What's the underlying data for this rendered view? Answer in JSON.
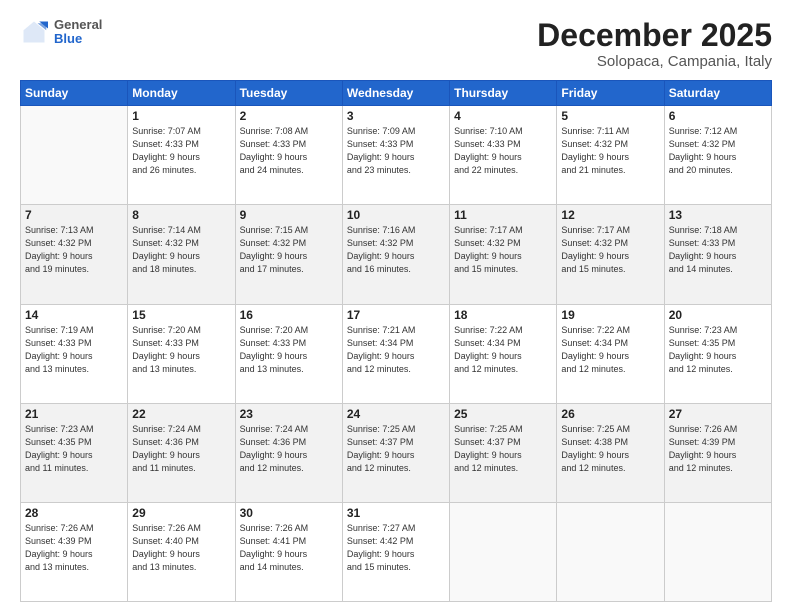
{
  "logo": {
    "general": "General",
    "blue": "Blue"
  },
  "header": {
    "month": "December 2025",
    "location": "Solopaca, Campania, Italy"
  },
  "days_of_week": [
    "Sunday",
    "Monday",
    "Tuesday",
    "Wednesday",
    "Thursday",
    "Friday",
    "Saturday"
  ],
  "weeks": [
    [
      {
        "day": "",
        "info": ""
      },
      {
        "day": "1",
        "info": "Sunrise: 7:07 AM\nSunset: 4:33 PM\nDaylight: 9 hours\nand 26 minutes."
      },
      {
        "day": "2",
        "info": "Sunrise: 7:08 AM\nSunset: 4:33 PM\nDaylight: 9 hours\nand 24 minutes."
      },
      {
        "day": "3",
        "info": "Sunrise: 7:09 AM\nSunset: 4:33 PM\nDaylight: 9 hours\nand 23 minutes."
      },
      {
        "day": "4",
        "info": "Sunrise: 7:10 AM\nSunset: 4:33 PM\nDaylight: 9 hours\nand 22 minutes."
      },
      {
        "day": "5",
        "info": "Sunrise: 7:11 AM\nSunset: 4:32 PM\nDaylight: 9 hours\nand 21 minutes."
      },
      {
        "day": "6",
        "info": "Sunrise: 7:12 AM\nSunset: 4:32 PM\nDaylight: 9 hours\nand 20 minutes."
      }
    ],
    [
      {
        "day": "7",
        "info": "Sunrise: 7:13 AM\nSunset: 4:32 PM\nDaylight: 9 hours\nand 19 minutes."
      },
      {
        "day": "8",
        "info": "Sunrise: 7:14 AM\nSunset: 4:32 PM\nDaylight: 9 hours\nand 18 minutes."
      },
      {
        "day": "9",
        "info": "Sunrise: 7:15 AM\nSunset: 4:32 PM\nDaylight: 9 hours\nand 17 minutes."
      },
      {
        "day": "10",
        "info": "Sunrise: 7:16 AM\nSunset: 4:32 PM\nDaylight: 9 hours\nand 16 minutes."
      },
      {
        "day": "11",
        "info": "Sunrise: 7:17 AM\nSunset: 4:32 PM\nDaylight: 9 hours\nand 15 minutes."
      },
      {
        "day": "12",
        "info": "Sunrise: 7:17 AM\nSunset: 4:32 PM\nDaylight: 9 hours\nand 15 minutes."
      },
      {
        "day": "13",
        "info": "Sunrise: 7:18 AM\nSunset: 4:33 PM\nDaylight: 9 hours\nand 14 minutes."
      }
    ],
    [
      {
        "day": "14",
        "info": "Sunrise: 7:19 AM\nSunset: 4:33 PM\nDaylight: 9 hours\nand 13 minutes."
      },
      {
        "day": "15",
        "info": "Sunrise: 7:20 AM\nSunset: 4:33 PM\nDaylight: 9 hours\nand 13 minutes."
      },
      {
        "day": "16",
        "info": "Sunrise: 7:20 AM\nSunset: 4:33 PM\nDaylight: 9 hours\nand 13 minutes."
      },
      {
        "day": "17",
        "info": "Sunrise: 7:21 AM\nSunset: 4:34 PM\nDaylight: 9 hours\nand 12 minutes."
      },
      {
        "day": "18",
        "info": "Sunrise: 7:22 AM\nSunset: 4:34 PM\nDaylight: 9 hours\nand 12 minutes."
      },
      {
        "day": "19",
        "info": "Sunrise: 7:22 AM\nSunset: 4:34 PM\nDaylight: 9 hours\nand 12 minutes."
      },
      {
        "day": "20",
        "info": "Sunrise: 7:23 AM\nSunset: 4:35 PM\nDaylight: 9 hours\nand 12 minutes."
      }
    ],
    [
      {
        "day": "21",
        "info": "Sunrise: 7:23 AM\nSunset: 4:35 PM\nDaylight: 9 hours\nand 11 minutes."
      },
      {
        "day": "22",
        "info": "Sunrise: 7:24 AM\nSunset: 4:36 PM\nDaylight: 9 hours\nand 11 minutes."
      },
      {
        "day": "23",
        "info": "Sunrise: 7:24 AM\nSunset: 4:36 PM\nDaylight: 9 hours\nand 12 minutes."
      },
      {
        "day": "24",
        "info": "Sunrise: 7:25 AM\nSunset: 4:37 PM\nDaylight: 9 hours\nand 12 minutes."
      },
      {
        "day": "25",
        "info": "Sunrise: 7:25 AM\nSunset: 4:37 PM\nDaylight: 9 hours\nand 12 minutes."
      },
      {
        "day": "26",
        "info": "Sunrise: 7:25 AM\nSunset: 4:38 PM\nDaylight: 9 hours\nand 12 minutes."
      },
      {
        "day": "27",
        "info": "Sunrise: 7:26 AM\nSunset: 4:39 PM\nDaylight: 9 hours\nand 12 minutes."
      }
    ],
    [
      {
        "day": "28",
        "info": "Sunrise: 7:26 AM\nSunset: 4:39 PM\nDaylight: 9 hours\nand 13 minutes."
      },
      {
        "day": "29",
        "info": "Sunrise: 7:26 AM\nSunset: 4:40 PM\nDaylight: 9 hours\nand 13 minutes."
      },
      {
        "day": "30",
        "info": "Sunrise: 7:26 AM\nSunset: 4:41 PM\nDaylight: 9 hours\nand 14 minutes."
      },
      {
        "day": "31",
        "info": "Sunrise: 7:27 AM\nSunset: 4:42 PM\nDaylight: 9 hours\nand 15 minutes."
      },
      {
        "day": "",
        "info": ""
      },
      {
        "day": "",
        "info": ""
      },
      {
        "day": "",
        "info": ""
      }
    ]
  ]
}
